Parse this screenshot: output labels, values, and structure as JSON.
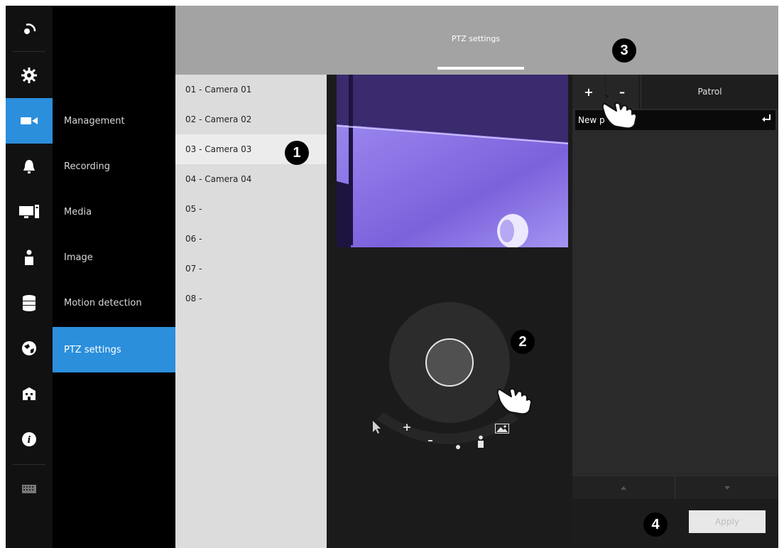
{
  "header": {
    "title": "PTZ settings"
  },
  "rail": {
    "icons": [
      "logo-icon",
      "gear-icon",
      "camera-icon",
      "alarm-bell-icon",
      "computer-icon",
      "person-icon",
      "storage-icon",
      "network-globe-icon",
      "building-icon",
      "info-icon",
      "keyboard-icon"
    ],
    "active": "camera-icon"
  },
  "subnav": {
    "items": [
      {
        "label": "Management"
      },
      {
        "label": "Recording"
      },
      {
        "label": "Media"
      },
      {
        "label": "Image"
      },
      {
        "label": "Motion detection"
      },
      {
        "label": "PTZ settings"
      }
    ],
    "active": "PTZ settings"
  },
  "cameras": {
    "items": [
      {
        "label": "01 - Camera 01"
      },
      {
        "label": "02 - Camera 02"
      },
      {
        "label": "03 - Camera 03"
      },
      {
        "label": "04 - Camera 04"
      },
      {
        "label": "05 -"
      },
      {
        "label": "06 -"
      },
      {
        "label": "07 -"
      },
      {
        "label": "08 -"
      }
    ],
    "selected": "03 - Camera 03"
  },
  "ptz": {
    "toolbar": {
      "plus": "+",
      "minus": "–"
    }
  },
  "patrol": {
    "add_label": "+",
    "remove_label": "–",
    "title": "Patrol",
    "input_value": "New p"
  },
  "apply_label": "Apply",
  "callouts": {
    "one": "1",
    "two": "2",
    "three": "3",
    "four": "4"
  },
  "colors": {
    "accent": "#2b8fdc",
    "header": "#a3a3a3",
    "preview": "#7d63d8"
  }
}
